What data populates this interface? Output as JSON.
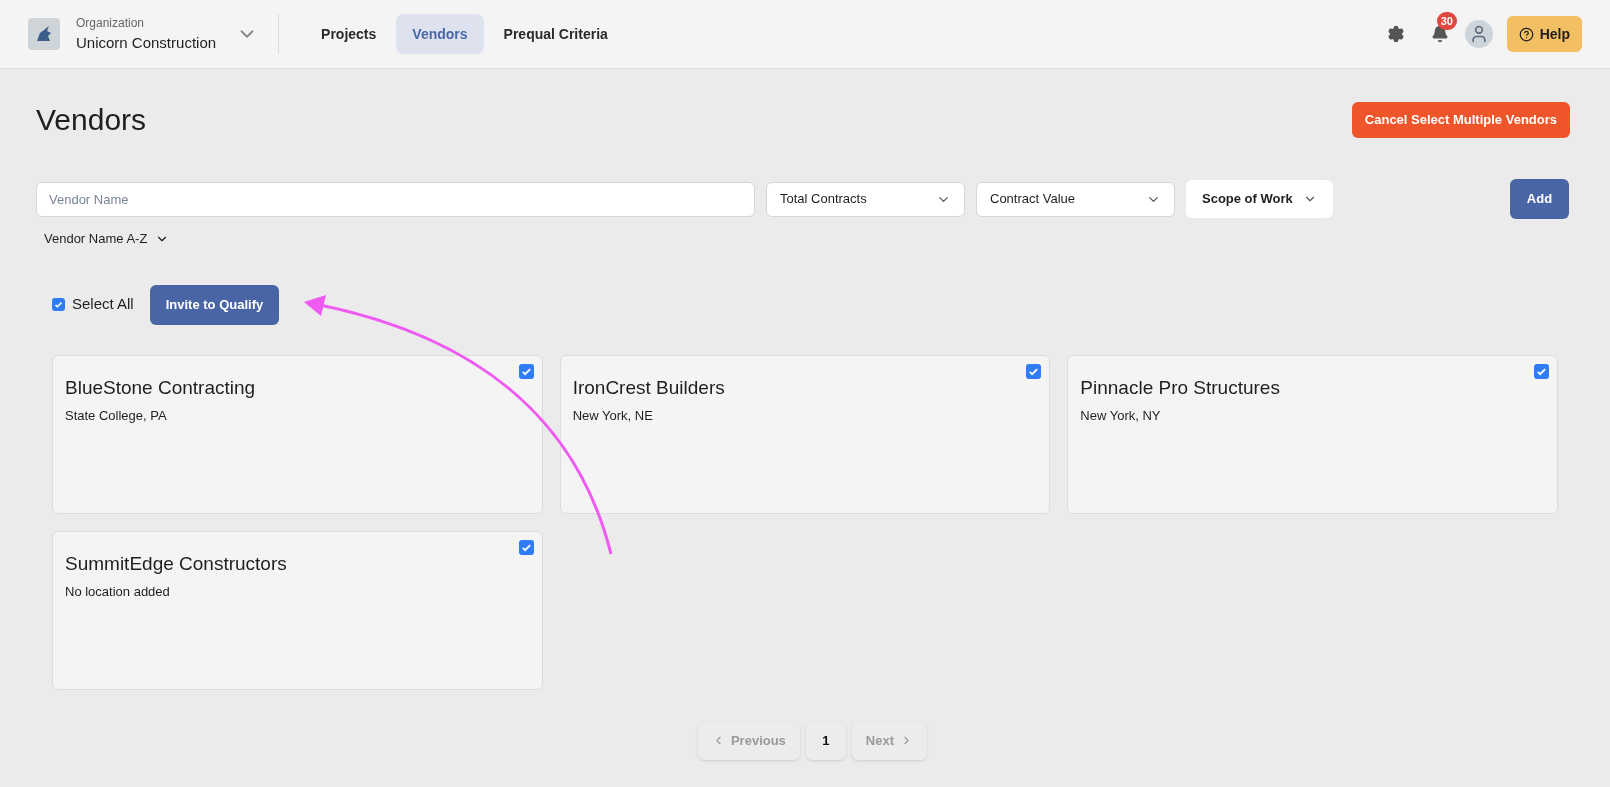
{
  "header": {
    "org_label": "Organization",
    "org_name": "Unicorn Construction",
    "nav": [
      {
        "label": "Projects",
        "selected": false
      },
      {
        "label": "Vendors",
        "selected": true
      },
      {
        "label": "Prequal Criteria",
        "selected": false
      }
    ],
    "notification_count": "30",
    "help": "Help"
  },
  "page": {
    "title": "Vendors",
    "cancel_button": "Cancel Select Multiple Vendors"
  },
  "filters": {
    "search": {
      "placeholder": "Vendor Name"
    },
    "dropdowns": [
      {
        "label": "Total Contracts",
        "kind": "select"
      },
      {
        "label": "Contract Value",
        "kind": "select"
      },
      {
        "label": "Scope of Work",
        "kind": "menu"
      }
    ],
    "add_button": "Add",
    "sort": "Vendor Name A-Z"
  },
  "selection": {
    "select_all": {
      "label": "Select All",
      "checked": true
    },
    "invite_button": "Invite to Qualify"
  },
  "vendors": [
    {
      "name": "BlueStone Contracting",
      "location": "State College, PA",
      "checked": true
    },
    {
      "name": "IronCrest Builders",
      "location": "New York, NE",
      "checked": true
    },
    {
      "name": "Pinnacle Pro Structures",
      "location": "New York, NY",
      "checked": true
    },
    {
      "name": "SummitEdge Constructors",
      "location": "No location added",
      "checked": true
    }
  ],
  "pagination": {
    "previous": {
      "label": "Previous",
      "disabled": true
    },
    "pages": [
      {
        "label": "1",
        "selected": true
      }
    ],
    "next": {
      "label": "Next",
      "disabled": true
    }
  }
}
